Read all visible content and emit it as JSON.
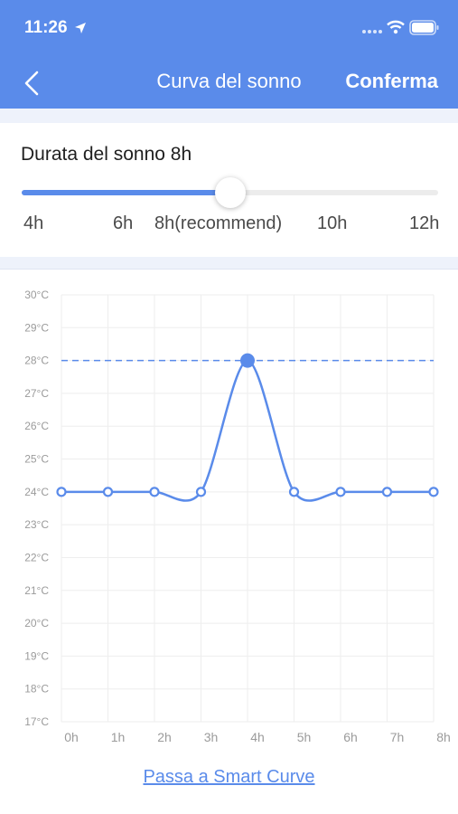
{
  "status_bar": {
    "time": "11:26"
  },
  "header": {
    "title": "Curva del sonno",
    "confirm_label": "Conferma"
  },
  "slider": {
    "label": "Durata del sonno 8h",
    "value_hours": 8,
    "min_hours": 4,
    "max_hours": 12,
    "ticks": [
      "4h",
      "6h",
      "8h(recommend)",
      "10h",
      "12h"
    ]
  },
  "chart_data": {
    "type": "line",
    "x": [
      "0h",
      "1h",
      "2h",
      "3h",
      "4h",
      "5h",
      "6h",
      "7h",
      "8h"
    ],
    "series": [
      {
        "values": [
          24,
          24,
          24,
          24,
          28,
          24,
          24,
          24,
          24
        ]
      }
    ],
    "highlighted_point": {
      "x": "4h",
      "y": 28
    },
    "reference_line": 28,
    "y_ticks": [
      "30°C",
      "29°C",
      "28°C",
      "27°C",
      "26°C",
      "25°C",
      "24°C",
      "23°C",
      "22°C",
      "21°C",
      "20°C",
      "19°C",
      "18°C",
      "17°C"
    ],
    "ylim": [
      17,
      30
    ],
    "grid": true,
    "color": "#5a8bea"
  },
  "footer": {
    "link_label": "Passa a Smart Curve"
  },
  "colors": {
    "accent": "#5a8bea",
    "background_band": "#eef2fb"
  }
}
